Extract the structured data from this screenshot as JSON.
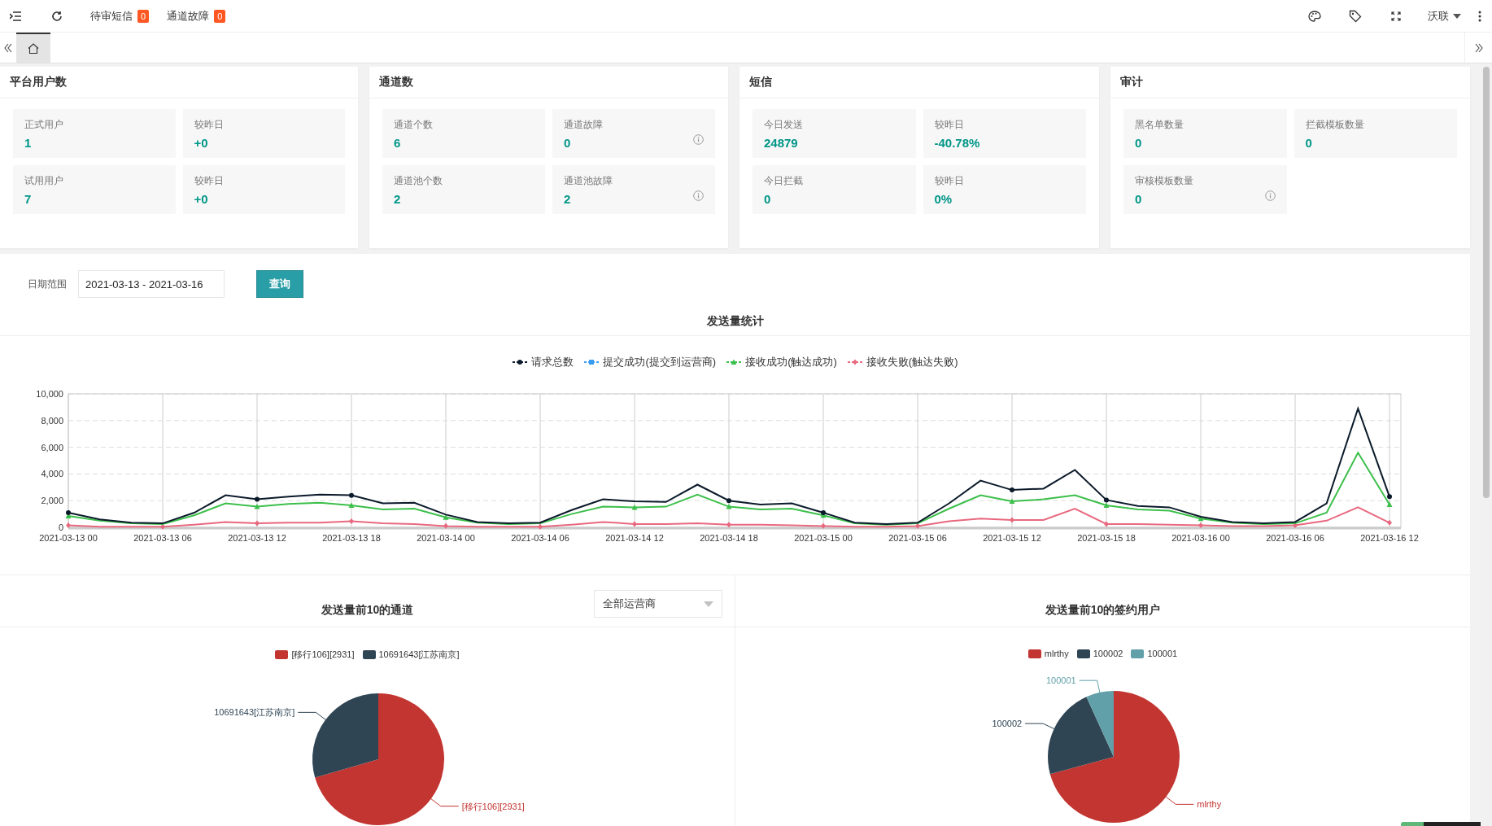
{
  "toolbar": {
    "notices": [
      {
        "label": "待审短信",
        "count": "0"
      },
      {
        "label": "通道故障",
        "count": "0"
      }
    ],
    "user": "沃联"
  },
  "tabs": [
    {
      "selected": true
    }
  ],
  "cards": [
    {
      "title": "平台用户数",
      "stats": [
        {
          "label": "正式用户",
          "value": "1",
          "info": false
        },
        {
          "label": "较昨日",
          "value": "+0",
          "info": false
        },
        {
          "label": "试用用户",
          "value": "7",
          "info": false
        },
        {
          "label": "较昨日",
          "value": "+0",
          "info": false
        }
      ]
    },
    {
      "title": "通道数",
      "stats": [
        {
          "label": "通道个数",
          "value": "6",
          "info": false
        },
        {
          "label": "通道故障",
          "value": "0",
          "info": true
        },
        {
          "label": "通道池个数",
          "value": "2",
          "info": false
        },
        {
          "label": "通道池故障",
          "value": "2",
          "info": true
        }
      ]
    },
    {
      "title": "短信",
      "stats": [
        {
          "label": "今日发送",
          "value": "24879",
          "info": false
        },
        {
          "label": "较昨日",
          "value": "-40.78%",
          "info": false
        },
        {
          "label": "今日拦截",
          "value": "0",
          "info": false
        },
        {
          "label": "较昨日",
          "value": "0%",
          "info": false
        }
      ]
    },
    {
      "title": "审计",
      "stats": [
        {
          "label": "黑名单数量",
          "value": "0",
          "info": false
        },
        {
          "label": "拦截模板数量",
          "value": "0",
          "info": false
        },
        {
          "label": "审核模板数量",
          "value": "0",
          "info": true
        }
      ]
    }
  ],
  "filter": {
    "label": "日期范围",
    "value": "2021-03-13 - 2021-03-16",
    "button": "查询"
  },
  "send_stats": {
    "chart_data": {
      "type": "line",
      "title": "发送量统计",
      "categories": [
        "2021-03-13 00",
        null,
        null,
        "2021-03-13 06",
        null,
        null,
        "2021-03-13 12",
        null,
        null,
        "2021-03-13 18",
        null,
        null,
        "2021-03-14 00",
        null,
        null,
        "2021-03-14 06",
        null,
        null,
        "2021-03-14 12",
        null,
        null,
        "2021-03-14 18",
        null,
        null,
        "2021-03-15 00",
        null,
        null,
        "2021-03-15 06",
        null,
        null,
        "2021-03-15 12",
        null,
        null,
        "2021-03-15 18",
        null,
        null,
        "2021-03-16 00",
        null,
        null,
        "2021-03-16 06",
        null,
        null,
        "2021-03-16 12"
      ],
      "ylim": [
        0,
        10000
      ],
      "grid": true,
      "legend": "top",
      "yticks": [
        0,
        {
          "value": 2000,
          "label": "2,000"
        },
        {
          "value": 4000,
          "label": "4,000"
        },
        {
          "value": 6000,
          "label": "6,000"
        },
        {
          "value": 8000,
          "label": "8,000"
        },
        {
          "value": 10000,
          "label": "10,000"
        }
      ],
      "series": [
        {
          "name": "请求总数",
          "color": "#0b1a2a",
          "values": [
            1100,
            600,
            350,
            300,
            1100,
            2400,
            2100,
            2300,
            2450,
            2400,
            1800,
            1850,
            950,
            400,
            300,
            350,
            1300,
            2100,
            1950,
            1900,
            3200,
            2000,
            1700,
            1800,
            1100,
            350,
            250,
            350,
            1800,
            3500,
            2800,
            2900,
            4300,
            2050,
            1600,
            1500,
            800,
            400,
            300,
            400,
            1800,
            8900,
            2300
          ]
        },
        {
          "name": "提交成功(提交到运营商)",
          "color": "#3a9cf0",
          "values": [
            null,
            null,
            null,
            null,
            null,
            null,
            null,
            null,
            null,
            null,
            null,
            null,
            null,
            null,
            null,
            null,
            null,
            null,
            null,
            null,
            null,
            null,
            null,
            null,
            null,
            null,
            null,
            null,
            null,
            null,
            null,
            null,
            null,
            null,
            null,
            null,
            null,
            null,
            null,
            null,
            null,
            null,
            null
          ]
        },
        {
          "name": "接收成功(触达成功)",
          "color": "#3cbf4a",
          "values": [
            850,
            500,
            300,
            250,
            900,
            1800,
            1550,
            1750,
            1850,
            1650,
            1350,
            1400,
            750,
            350,
            250,
            300,
            1000,
            1550,
            1500,
            1550,
            2450,
            1550,
            1350,
            1400,
            900,
            300,
            200,
            300,
            1400,
            2400,
            1950,
            2100,
            2400,
            1650,
            1350,
            1250,
            650,
            350,
            250,
            300,
            1100,
            5600,
            1700
          ]
        },
        {
          "name": "接收失败(触达失败)",
          "color": "#e8697f",
          "values": [
            150,
            50,
            50,
            50,
            200,
            400,
            300,
            350,
            350,
            450,
            300,
            250,
            100,
            50,
            50,
            50,
            200,
            400,
            250,
            250,
            300,
            200,
            200,
            150,
            100,
            50,
            50,
            100,
            450,
            650,
            550,
            550,
            1400,
            250,
            250,
            200,
            150,
            100,
            100,
            150,
            500,
            1500,
            350
          ]
        }
      ]
    }
  },
  "pies": [
    {
      "title": "发送量前10的通道",
      "select": {
        "value": "全部运营商"
      },
      "legend": [
        {
          "label": "[移行106][2931]",
          "color": "#c23531"
        },
        {
          "label": "10691643[江苏南京]",
          "color": "#2f4554"
        }
      ],
      "chart_data": {
        "type": "pie",
        "categories": [
          "[移行106][2931]",
          "10691643[江苏南京]"
        ],
        "values": [
          70.5,
          29.5
        ],
        "colors": [
          "#c23531",
          "#2f4554"
        ]
      }
    },
    {
      "title": "发送量前10的签约用户",
      "legend": [
        {
          "label": "mlrthy",
          "color": "#c23531"
        },
        {
          "label": "100002",
          "color": "#2f4554"
        },
        {
          "label": "100001",
          "color": "#61a0a8"
        }
      ],
      "chart_data": {
        "type": "pie",
        "categories": [
          "mlrthy",
          "100002",
          "100001"
        ],
        "values": [
          70.8,
          22.4,
          6.8
        ],
        "colors": [
          "#c23531",
          "#2f4554",
          "#61a0a8"
        ]
      }
    }
  ]
}
